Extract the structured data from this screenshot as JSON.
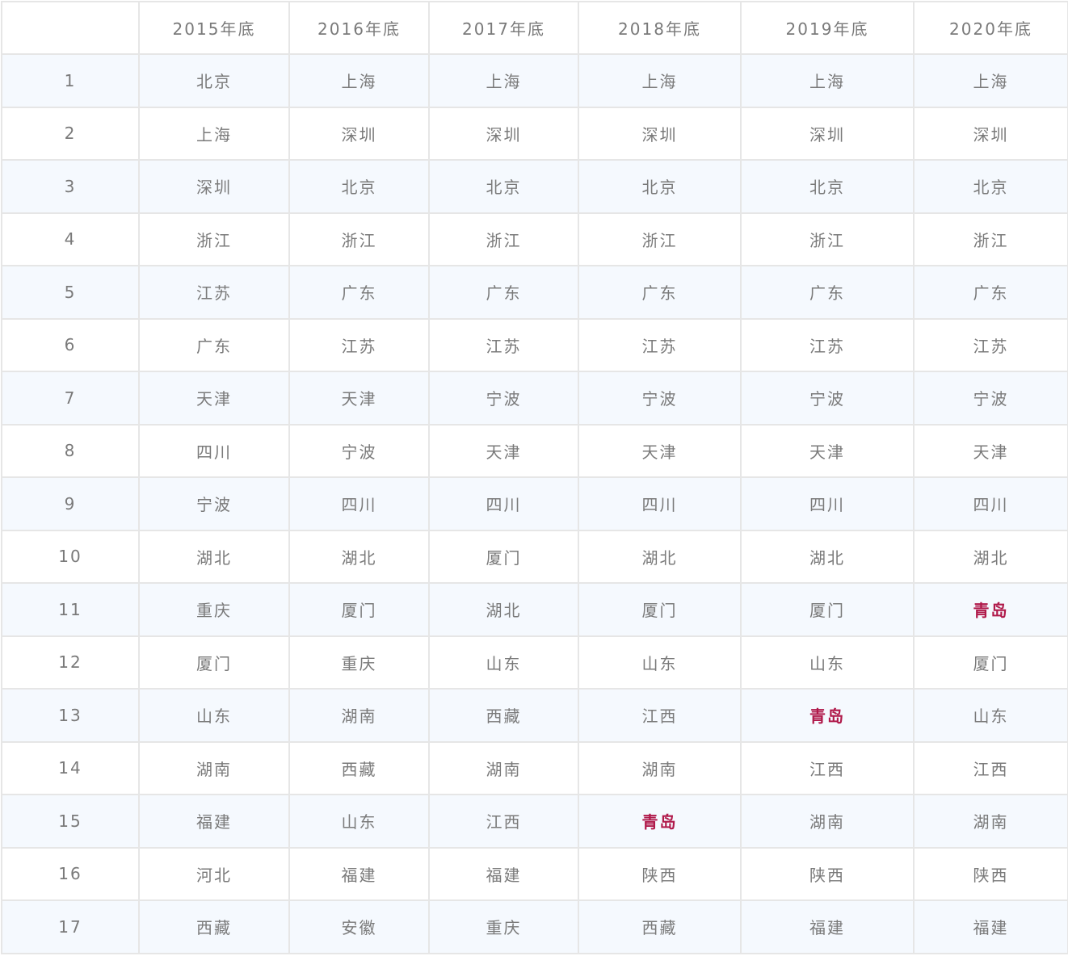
{
  "table": {
    "corner_label": "",
    "headers": [
      "2015年底",
      "2016年底",
      "2017年底",
      "2018年底",
      "2019年底",
      "2020年底"
    ],
    "highlight_color": "#b0194a",
    "rows": [
      {
        "rank": "1",
        "cells": [
          "北京",
          "上海",
          "上海",
          "上海",
          "上海",
          "上海"
        ]
      },
      {
        "rank": "2",
        "cells": [
          "上海",
          "深圳",
          "深圳",
          "深圳",
          "深圳",
          "深圳"
        ]
      },
      {
        "rank": "3",
        "cells": [
          "深圳",
          "北京",
          "北京",
          "北京",
          "北京",
          "北京"
        ]
      },
      {
        "rank": "4",
        "cells": [
          "浙江",
          "浙江",
          "浙江",
          "浙江",
          "浙江",
          "浙江"
        ]
      },
      {
        "rank": "5",
        "cells": [
          "江苏",
          "广东",
          "广东",
          "广东",
          "广东",
          "广东"
        ]
      },
      {
        "rank": "6",
        "cells": [
          "广东",
          "江苏",
          "江苏",
          "江苏",
          "江苏",
          "江苏"
        ]
      },
      {
        "rank": "7",
        "cells": [
          "天津",
          "天津",
          "宁波",
          "宁波",
          "宁波",
          "宁波"
        ]
      },
      {
        "rank": "8",
        "cells": [
          "四川",
          "宁波",
          "天津",
          "天津",
          "天津",
          "天津"
        ]
      },
      {
        "rank": "9",
        "cells": [
          "宁波",
          "四川",
          "四川",
          "四川",
          "四川",
          "四川"
        ]
      },
      {
        "rank": "10",
        "cells": [
          "湖北",
          "湖北",
          "厦门",
          "湖北",
          "湖北",
          "湖北"
        ]
      },
      {
        "rank": "11",
        "cells": [
          "重庆",
          "厦门",
          "湖北",
          "厦门",
          "厦门",
          "青岛"
        ]
      },
      {
        "rank": "12",
        "cells": [
          "厦门",
          "重庆",
          "山东",
          "山东",
          "山东",
          "厦门"
        ]
      },
      {
        "rank": "13",
        "cells": [
          "山东",
          "湖南",
          "西藏",
          "江西",
          "青岛",
          "山东"
        ]
      },
      {
        "rank": "14",
        "cells": [
          "湖南",
          "西藏",
          "湖南",
          "湖南",
          "江西",
          "江西"
        ]
      },
      {
        "rank": "15",
        "cells": [
          "福建",
          "山东",
          "江西",
          "青岛",
          "湖南",
          "湖南"
        ]
      },
      {
        "rank": "16",
        "cells": [
          "河北",
          "福建",
          "福建",
          "陕西",
          "陕西",
          "陕西"
        ]
      },
      {
        "rank": "17",
        "cells": [
          "西藏",
          "安徽",
          "重庆",
          "西藏",
          "福建",
          "福建"
        ]
      }
    ],
    "highlighted_cells": [
      {
        "row": 10,
        "col": 5
      },
      {
        "row": 12,
        "col": 4
      },
      {
        "row": 14,
        "col": 3
      }
    ]
  }
}
